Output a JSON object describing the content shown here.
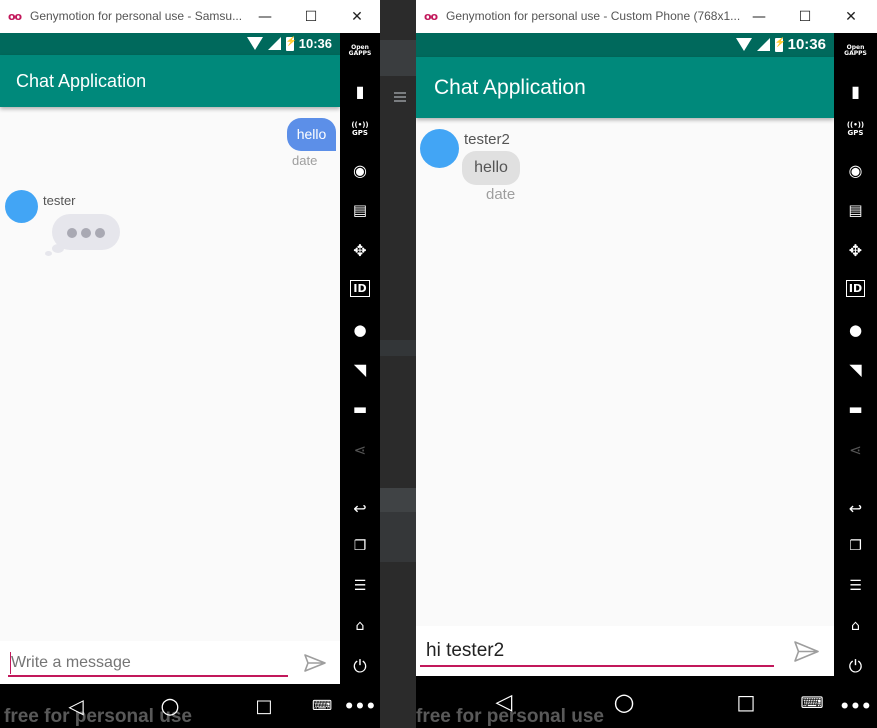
{
  "left_window": {
    "title": "Genymotion for personal use - Samsu...",
    "status_time": "10:36",
    "app_title": "Chat Application",
    "messages": {
      "outgoing_text": "hello",
      "outgoing_date": "date",
      "incoming_sender": "tester"
    },
    "input_placeholder": "Write a message",
    "input_value": "",
    "watermark": "free for personal use"
  },
  "right_window": {
    "title": "Genymotion for personal use - Custom Phone (768x1...",
    "status_time": "10:36",
    "app_title": "Chat Application",
    "messages": {
      "incoming_sender": "tester2",
      "incoming_text": "hello",
      "incoming_date": "date"
    },
    "input_value": "hi tester2",
    "watermark": "free for personal use"
  },
  "window_controls": {
    "minimize": "—",
    "maximize": "☐",
    "close": "✕"
  },
  "sidebar": {
    "items": [
      {
        "icon": "open-gapps-icon",
        "label": "Open GAPPS"
      },
      {
        "icon": "battery-icon"
      },
      {
        "icon": "gps-icon",
        "label": "GPS"
      },
      {
        "icon": "camera-icon"
      },
      {
        "icon": "video-icon"
      },
      {
        "icon": "dpad-icon"
      },
      {
        "icon": "id-icon",
        "label": "ID"
      },
      {
        "icon": "disk-icon"
      },
      {
        "icon": "rss-icon"
      },
      {
        "icon": "sms-icon"
      },
      {
        "icon": "share-icon"
      },
      {
        "icon": "back-icon"
      },
      {
        "icon": "recents-icon"
      },
      {
        "icon": "menu-icon"
      },
      {
        "icon": "home-icon"
      },
      {
        "icon": "power-icon"
      },
      {
        "icon": "more-icon"
      }
    ]
  },
  "colors": {
    "status_bar": "#00695c",
    "app_bar": "#00897b",
    "outgoing_bubble": "#5c8fe8",
    "avatar": "#42a5f5",
    "accent": "#c2185b"
  }
}
